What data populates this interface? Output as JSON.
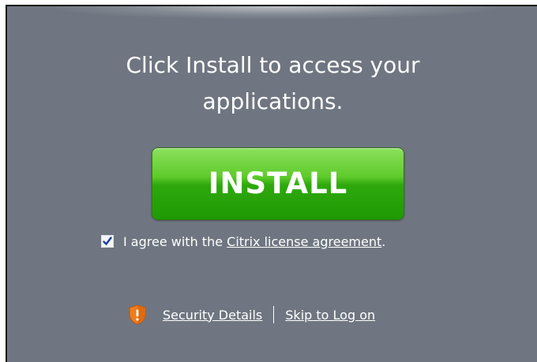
{
  "prompt": {
    "line1": "Click Install to access your",
    "line2": "applications."
  },
  "install_button": {
    "label": "INSTALL"
  },
  "agreement": {
    "checked": true,
    "text_prefix": "I agree with the ",
    "link_text": "Citrix license agreement",
    "text_suffix": "."
  },
  "footer": {
    "security_icon": "shield-warning-icon",
    "security_link": "Security Details",
    "skip_link": "Skip to Log on"
  },
  "colors": {
    "background": "#6f7681",
    "button_green": "#2ea80c",
    "shield_orange": "#f07c1c"
  }
}
